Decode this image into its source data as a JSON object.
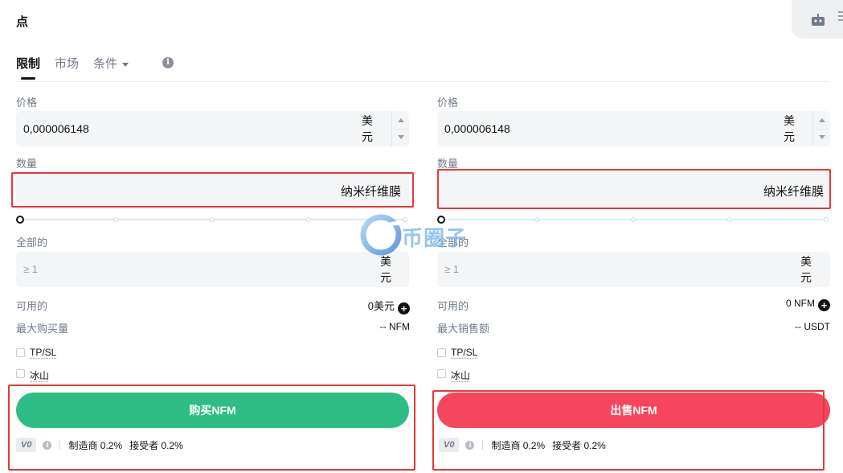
{
  "header": {
    "title": "点"
  },
  "order_tabs": {
    "limit": "限制",
    "market": "市场",
    "conditional": "条件",
    "info_icon": "info-icon"
  },
  "buy": {
    "price_label": "价格",
    "price_value": "0,000006148",
    "price_unit_top": "美",
    "price_unit_bottom": "元",
    "qty_label": "数量",
    "qty_unit": "纳米纤维膜",
    "slider_value": 0,
    "total_label": "全部的",
    "total_placeholder": "≥ 1",
    "total_unit_top": "美",
    "total_unit_bottom": "元",
    "available_label": "可用的",
    "available_value": "0美元",
    "max_label": "最大购买量",
    "max_value": "-- NFM",
    "tpsl_label": "TP/SL",
    "iceberg_label": "冰山",
    "button_label": "购买NFM",
    "vip_label": "V0",
    "maker_fee": "制造商 0.2%",
    "taker_fee": "接受者 0.2%"
  },
  "sell": {
    "price_label": "价格",
    "price_value": "0,000006148",
    "price_unit_top": "美",
    "price_unit_bottom": "元",
    "qty_label": "数量",
    "qty_unit": "纳米纤维膜",
    "slider_value": 0,
    "total_label": "全部的",
    "total_placeholder": "≥ 1",
    "total_unit_top": "美",
    "total_unit_bottom": "元",
    "available_label": "可用的",
    "available_value": "0 NFM",
    "max_label": "最大销售额",
    "max_value": "-- USDT",
    "tpsl_label": "TP/SL",
    "iceberg_label": "冰山",
    "button_label": "出售NFM",
    "vip_label": "V0",
    "maker_fee": "制造商 0.2%",
    "taker_fee": "接受者 0.2%"
  },
  "watermark": {
    "text": "币圈子"
  },
  "colors": {
    "buy": "#2ebd85",
    "sell": "#f6465d",
    "highlight": "#e53935"
  }
}
